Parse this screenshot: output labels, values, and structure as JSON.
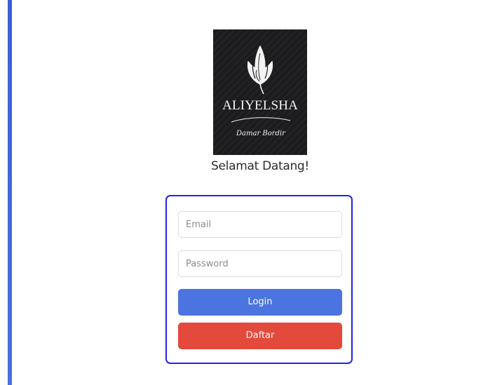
{
  "branding": {
    "logo_name": "ALIYELSHA",
    "logo_tagline": "Damar Bordir",
    "logo_icon": "lotus-flower-icon"
  },
  "welcome_text": "Selamat Datang!",
  "form": {
    "email_placeholder": "Email",
    "password_placeholder": "Password",
    "login_label": "Login",
    "register_label": "Daftar"
  },
  "colors": {
    "accent_bar": "#3a5fd6",
    "card_border": "#2222ee",
    "login_button": "#4c74e0",
    "register_button": "#e34a3c",
    "logo_background": "#1c1b1d"
  }
}
